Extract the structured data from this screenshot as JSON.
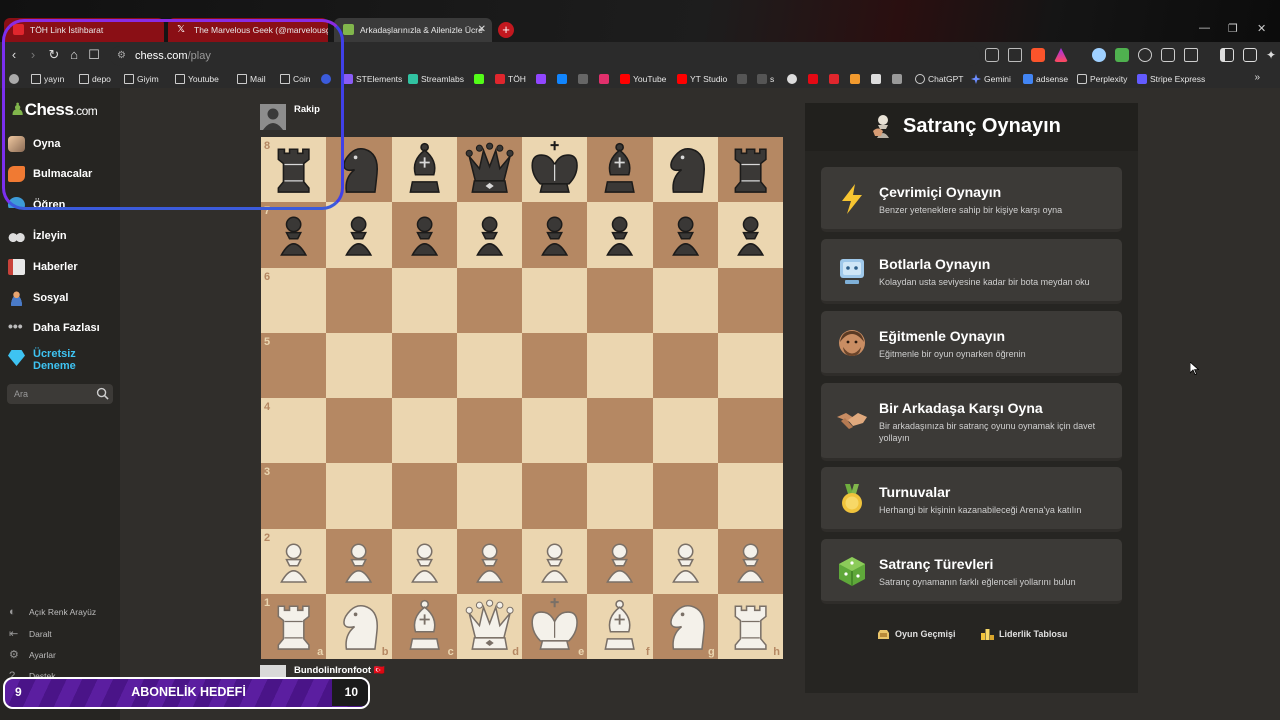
{
  "browser": {
    "tabs": [
      {
        "title": "TÖH Link İstihbarat",
        "favicon_color": "#e0262d"
      },
      {
        "title": "The Marvelous Geek (@marvelousge",
        "favicon_color": "#ffffff"
      },
      {
        "title": "Arkadaşlarınızla & Ailenizle Ücre",
        "favicon_color": "#81b64c"
      }
    ],
    "window_controls": {
      "minimize": "—",
      "restore": "❐",
      "close": "✕"
    },
    "new_tab": "+",
    "url_host": "chess.com",
    "url_path": "/play",
    "bookmarks": [
      "yayın",
      "depo",
      "Giyim",
      "Youtube",
      "Mail",
      "Coin",
      "STElements",
      "Streamlabs",
      "TÖH",
      "YouTube",
      "YT Studio",
      "s",
      "ChatGPT",
      "Gemini",
      "adsense",
      "Perplexity",
      "Stripe Express"
    ],
    "bookmarks_more": "»"
  },
  "sidebar": {
    "logo": {
      "text": "Chess",
      "suffix": ".com"
    },
    "items": [
      {
        "label": "Oyna"
      },
      {
        "label": "Bulmacalar"
      },
      {
        "label": "Öğren"
      },
      {
        "label": "İzleyin"
      },
      {
        "label": "Haberler"
      },
      {
        "label": "Sosyal"
      },
      {
        "label": "Daha Fazlası"
      }
    ],
    "trial": {
      "line1": "Ücretsiz",
      "line2": "Deneme"
    },
    "search_placeholder": "Ara",
    "bottom_links": [
      {
        "label": "Açık Renk Arayüz",
        "icon": "half-moon-icon"
      },
      {
        "label": "Daralt",
        "icon": "collapse-icon"
      },
      {
        "label": "Ayarlar",
        "icon": "gear-icon"
      },
      {
        "label": "Destek",
        "icon": "help-icon"
      }
    ]
  },
  "board": {
    "opponent": "Rakip",
    "player": "BundolinIronfoot",
    "player_flag": "🇹🇷",
    "ranks": [
      "8",
      "7",
      "6",
      "5",
      "4",
      "3",
      "2",
      "1"
    ],
    "files": [
      "a",
      "b",
      "c",
      "d",
      "e",
      "f",
      "g",
      "h"
    ],
    "colors": {
      "light": "#ebd6b0",
      "dark": "#b58863"
    },
    "position": [
      [
        "br",
        "bn",
        "bb",
        "bq",
        "bk",
        "bb",
        "bn",
        "br"
      ],
      [
        "bp",
        "bp",
        "bp",
        "bp",
        "bp",
        "bp",
        "bp",
        "bp"
      ],
      [
        "",
        "",
        "",
        "",
        "",
        "",
        "",
        ""
      ],
      [
        "",
        "",
        "",
        "",
        "",
        "",
        "",
        ""
      ],
      [
        "",
        "",
        "",
        "",
        "",
        "",
        "",
        ""
      ],
      [
        "",
        "",
        "",
        "",
        "",
        "",
        "",
        ""
      ],
      [
        "wp",
        "wp",
        "wp",
        "wp",
        "wp",
        "wp",
        "wp",
        "wp"
      ],
      [
        "wr",
        "wn",
        "wb",
        "wq",
        "wk",
        "wb",
        "wn",
        "wr"
      ]
    ]
  },
  "panel": {
    "title": "Satranç Oynayın",
    "options": [
      {
        "title": "Çevrimiçi Oynayın",
        "desc": "Benzer yeteneklere sahip bir kişiye karşı oyna",
        "icon": "lightning-icon"
      },
      {
        "title": "Botlarla Oynayın",
        "desc": "Kolaydan usta seviyesine kadar bir bota meydan oku",
        "icon": "robot-icon"
      },
      {
        "title": "Eğitmenle Oynayın",
        "desc": "Eğitmenle bir oyun oynarken öğrenin",
        "icon": "coach-icon"
      },
      {
        "title": "Bir Arkadaşa Karşı Oyna",
        "desc": "Bir arkadaşınıza bir satranç oyunu oynamak için davet yollayın",
        "icon": "handshake-icon"
      },
      {
        "title": "Turnuvalar",
        "desc": "Herhangi bir kişinin kazanabileceği Arena'ya katılın",
        "icon": "medal-icon"
      },
      {
        "title": "Satranç Türevleri",
        "desc": "Satranç oynamanın farklı eğlenceli yollarını bulun",
        "icon": "dice-icon"
      }
    ],
    "footer": {
      "history": "Oyun Geçmişi",
      "leaderboard": "Liderlik Tablosu"
    }
  },
  "overlay": {
    "goal_label": "ABONELİK HEDEFİ",
    "goal_current": "9",
    "goal_target": "10",
    "goal_progress_pct": 90
  }
}
